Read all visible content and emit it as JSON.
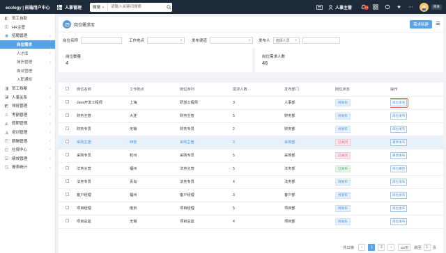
{
  "topbar": {
    "brand": "ecology | 前端用户中心",
    "module": "人事管理",
    "search_scope": "微搜",
    "search_placeholder": "请输入关键词搜索",
    "notification_count": "13",
    "user_name": "人事主管",
    "lang": "简体"
  },
  "sidebar": {
    "items": [
      {
        "label": "员工自助",
        "type": "top"
      },
      {
        "label": "HR主管",
        "type": "top"
      },
      {
        "label": "招聘管理",
        "type": "top",
        "arrow": "˄"
      },
      {
        "label": "岗位需求",
        "type": "sub",
        "active": true
      },
      {
        "label": "人才库",
        "type": "sub",
        "arrow": "˅"
      },
      {
        "label": "简历管理",
        "type": "sub",
        "arrow": "˅"
      },
      {
        "label": "面试管理",
        "type": "sub"
      },
      {
        "label": "入职通知",
        "type": "sub"
      },
      {
        "label": "员工档案",
        "type": "top",
        "arrow": "˅"
      },
      {
        "label": "人事关系",
        "type": "top",
        "arrow": "˅"
      },
      {
        "label": "排班管理",
        "type": "top",
        "arrow": "˅"
      },
      {
        "label": "考勤管理",
        "type": "top",
        "arrow": "˅"
      },
      {
        "label": "假期管理",
        "type": "top",
        "arrow": "˅"
      },
      {
        "label": "培训管理",
        "type": "top",
        "arrow": "˅"
      },
      {
        "label": "薪酬管理",
        "type": "top",
        "arrow": "˅"
      },
      {
        "label": "社保中心",
        "type": "top",
        "arrow": "˅"
      },
      {
        "label": "绩效管理",
        "type": "top",
        "arrow": "˅"
      },
      {
        "label": "报表统计",
        "type": "top",
        "arrow": "˅"
      }
    ]
  },
  "page": {
    "title": "岗位需求库",
    "new_button": "需求新建"
  },
  "filters": {
    "position_name_label": "岗位名称",
    "location_label": "工作地点",
    "channel_label": "发布渠道",
    "publisher_label": "发布人",
    "publisher_placeholder": "选择人员"
  },
  "stats": {
    "positions_label": "岗位数量",
    "positions_value": "4",
    "headcount_label": "岗位需求人数",
    "headcount_value": "46"
  },
  "table": {
    "columns": [
      "岗位名称",
      "工作地点",
      "岗位序列",
      "需求人数",
      "发布部门",
      "岗位状态",
      "操作"
    ],
    "rows": [
      {
        "name": "Java开发工程师",
        "location": "上海",
        "series": "研发工程师",
        "count": "3",
        "dept": "人事部",
        "status": "待发布",
        "status_type": "pending",
        "action": "岗位发布",
        "highlight_action": true
      },
      {
        "name": "财务主管",
        "location": "大连",
        "series": "财务主管",
        "count": "5",
        "dept": "财务部",
        "status": "待发布",
        "status_type": "pending",
        "action": "岗位发布"
      },
      {
        "name": "财务专员",
        "location": "无锡",
        "series": "财务专员",
        "count": "2",
        "dept": "财务部",
        "status": "待发布",
        "status_type": "pending",
        "action": "岗位发布"
      },
      {
        "name": "采购主管",
        "location": "西安",
        "series": "采购主管",
        "count": "3",
        "dept": "采购部",
        "status": "已关闭",
        "status_type": "closed",
        "action": "重新发布",
        "row_highlight": true
      },
      {
        "name": "采购专员",
        "location": "杭州",
        "series": "采购专员",
        "count": "5",
        "dept": "采购部",
        "status": "已关闭",
        "status_type": "closed",
        "action": "重新发布"
      },
      {
        "name": "法务主管",
        "location": "福州",
        "series": "法务主管",
        "count": "5",
        "dept": "法务部",
        "status": "已发布",
        "status_type": "open",
        "action": "岗位撤回"
      },
      {
        "name": "法务专员",
        "location": "青岛",
        "series": "法务专员",
        "count": "4",
        "dept": "法务部",
        "status": "待发布",
        "status_type": "pending",
        "action": "岗位发布"
      },
      {
        "name": "客户经理",
        "location": "福州",
        "series": "客户经理",
        "count": "3",
        "dept": "客户部",
        "status": "待发布",
        "status_type": "pending",
        "action": "岗位发布"
      },
      {
        "name": "项目经理",
        "location": "南京",
        "series": "项目经理",
        "count": "5",
        "dept": "项目部",
        "status": "待发布",
        "status_type": "pending",
        "action": "岗位发布"
      },
      {
        "name": "项目总监",
        "location": "无锡",
        "series": "项目总监",
        "count": "4",
        "dept": "项目部",
        "status": "待发布",
        "status_type": "pending",
        "action": "岗位发布"
      }
    ]
  },
  "pagination": {
    "total": "共12条",
    "prev": "‹",
    "page1": "1",
    "page2": "2",
    "next": "›",
    "page_size": "10/页",
    "jump_label": "跳至",
    "jump_value": "1",
    "page_unit": "页"
  }
}
